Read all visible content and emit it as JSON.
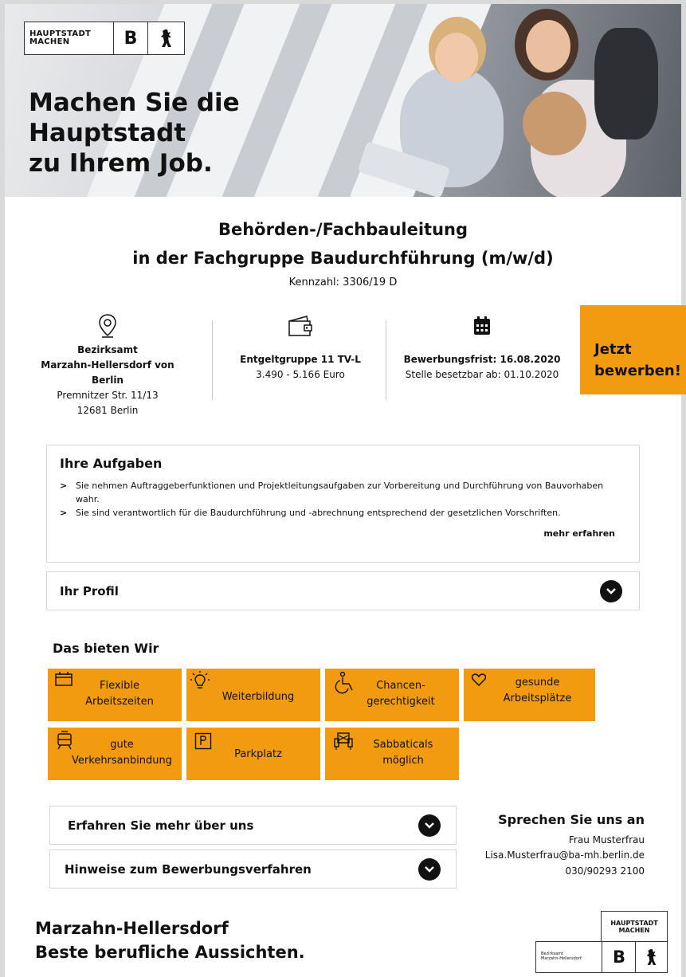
{
  "hero": {
    "logo_text_line1": "HAUPTSTADT",
    "logo_text_line2": "MACHEN",
    "logo_letter": "B",
    "headline_line1": "Machen Sie die",
    "headline_line2": "Hauptstadt",
    "headline_line3": "zu Ihrem Job."
  },
  "job": {
    "title_line1": "Behörden-/Fachbauleitung",
    "title_line2": "in der Fachgruppe Baudurchführung (m/w/d)",
    "reference": "Kennzahl: 3306/19 D"
  },
  "info": {
    "location": {
      "icon": "location-pin-icon",
      "line1": "Bezirksamt",
      "line2": "Marzahn-Hellersdorf von Berlin",
      "line3": "Premnitzer Str. 11/13",
      "line4": "12681 Berlin"
    },
    "salary": {
      "icon": "wallet-icon",
      "line1": "Entgeltgruppe 11 TV-L",
      "line2": "3.490 - 5.166 Euro"
    },
    "deadline": {
      "icon": "calendar-icon",
      "line1": "Bewerbungsfrist: 16.08.2020",
      "line2": "Stelle besetzbar ab: 01.10.2020"
    }
  },
  "apply_button": {
    "line1": "Jetzt",
    "line2": "bewerben!"
  },
  "tasks": {
    "title": "Ihre Aufgaben",
    "items": [
      "Sie nehmen Auftraggeberfunktionen und Projektleitungsaufgaben zur Vorbereitung und Durchführung von Bauvorhaben wahr.",
      "Sie sind verantwortlich für die Baudurchführung und -abrechnung entsprechend der gesetzlichen Vorschriften."
    ],
    "more_link": "mehr erfahren"
  },
  "profile": {
    "label": "Ihr Profil"
  },
  "benefits": {
    "title": "Das bieten Wir",
    "items": [
      {
        "icon": "calendar-icon",
        "line1": "Flexible",
        "line2": "Arbeitszeiten"
      },
      {
        "icon": "lightbulb-icon",
        "line1": "Weiterbildung",
        "line2": ""
      },
      {
        "icon": "wheelchair-icon",
        "line1": "Chancen-",
        "line2": "gerechtigkeit"
      },
      {
        "icon": "heart-icon",
        "line1": "gesunde",
        "line2": "Arbeitsplätze"
      },
      {
        "icon": "tram-icon",
        "line1": "gute",
        "line2": "Verkehrsanbindung"
      },
      {
        "icon": "parking-icon",
        "line1": "Parkplatz",
        "line2": ""
      },
      {
        "icon": "armchair-icon",
        "line1": "Sabbaticals",
        "line2": "möglich"
      }
    ]
  },
  "about": {
    "label": "Erfahren Sie mehr über uns"
  },
  "process": {
    "label": "Hinweise zum Bewerbungsverfahren"
  },
  "contact": {
    "title": "Sprechen Sie uns an",
    "name": "Frau Musterfrau",
    "email": "Lisa.Musterfrau@ba-mh.berlin.de",
    "phone": "030/90293 2100"
  },
  "footer": {
    "line1": "Marzahn-Hellersdorf",
    "line2": "Beste berufliche Aussichten.",
    "logo_text_line1": "HAUPTSTADT",
    "logo_text_line2": "MACHEN",
    "logo_small_line1": "Bezirksamt",
    "logo_small_line2": "Marzahn-Hellersdorf",
    "logo_letter": "B"
  },
  "colors": {
    "accent": "#f29b10",
    "text": "#111111",
    "border": "#d6d6d6"
  }
}
